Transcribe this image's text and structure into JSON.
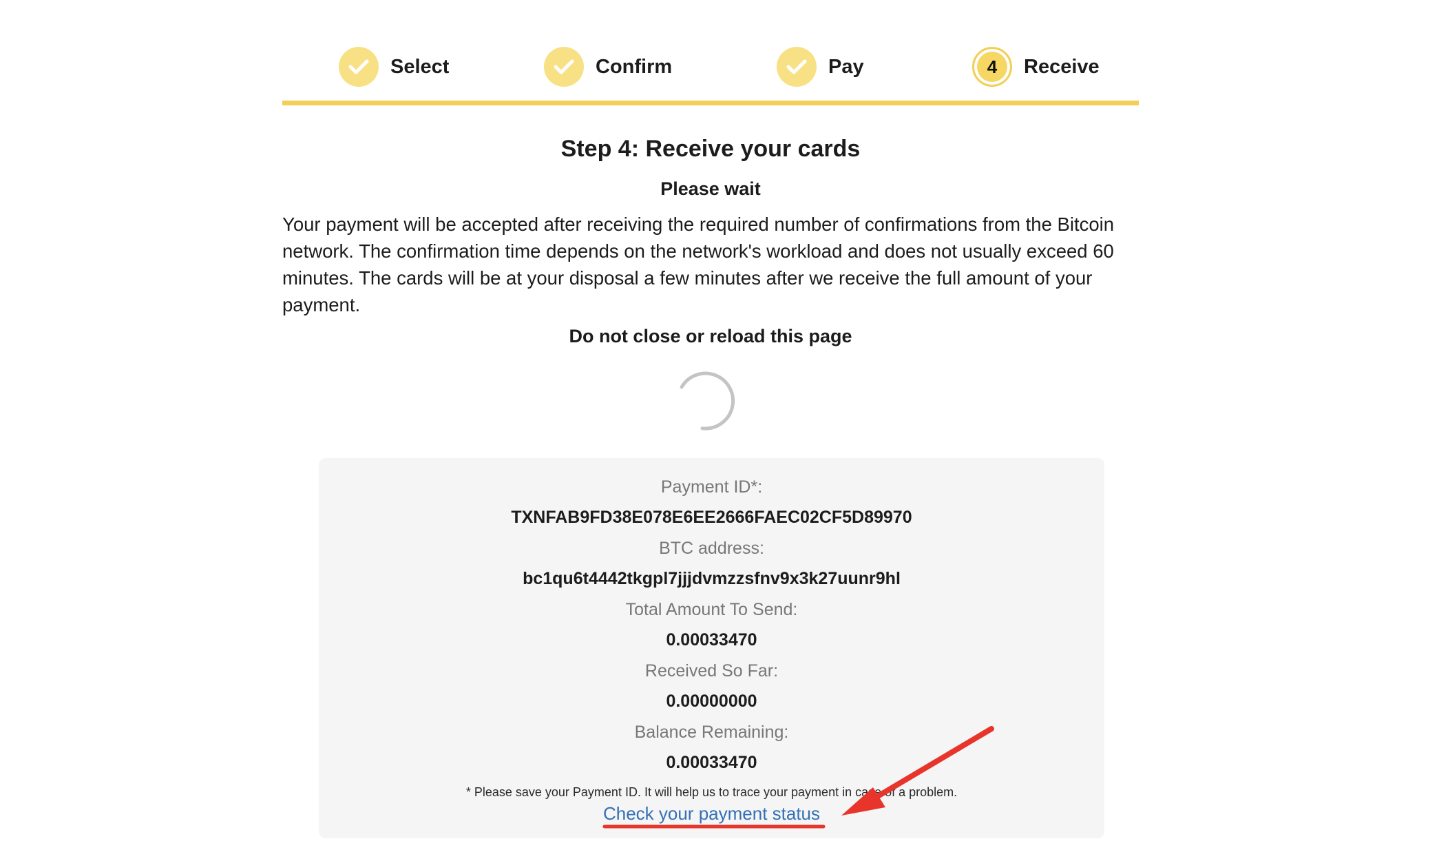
{
  "stepper": {
    "steps": [
      {
        "label": "Select",
        "state": "done",
        "icon": "check-icon"
      },
      {
        "label": "Confirm",
        "state": "done",
        "icon": "check-icon"
      },
      {
        "label": "Pay",
        "state": "done",
        "icon": "check-icon"
      },
      {
        "label": "Receive",
        "state": "active",
        "number": "4"
      }
    ],
    "accent_color": "#f3cf57"
  },
  "main": {
    "title_prefix": "Step 4:",
    "title_text": " Receive your cards",
    "wait_heading": "Please wait",
    "description": "Your payment will be accepted after receiving the required number of confirmations from the Bitcoin network. The confirmation time depends on the network's workload and does not usually exceed 60 minutes. The cards will be at your disposal a few minutes after we receive the full amount of your payment.",
    "warning": "Do not close or reload this page"
  },
  "payment": {
    "payment_id_label": "Payment ID*:",
    "payment_id": "TXNFAB9FD38E078E6EE2666FAEC02CF5D89970",
    "btc_address_label": "BTC address:",
    "btc_address": "bc1qu6t4442tkgpl7jjjdvmzzsfnv9x3k27uunr9hl",
    "total_label": "Total Amount To Send:",
    "total": "0.00033470",
    "received_label": "Received So Far:",
    "received": "0.00000000",
    "balance_label": "Balance Remaining:",
    "balance": "0.00033470",
    "note": "* Please save your Payment ID. It will help us to trace your payment in case of a problem.",
    "status_link": "Check your payment status",
    "link_color": "#3470b6"
  },
  "annotation": {
    "color": "#e8352b"
  }
}
